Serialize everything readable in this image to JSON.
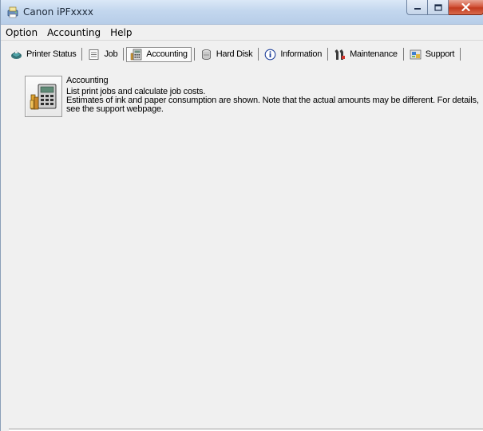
{
  "window": {
    "title": "Canon iPFxxxx",
    "icon": "canon-printer-app-icon",
    "caption_buttons": [
      "minimize",
      "maximize",
      "close"
    ]
  },
  "menubar": {
    "items": [
      {
        "label": "Option"
      },
      {
        "label": "Accounting"
      },
      {
        "label": "Help"
      }
    ]
  },
  "tabs": [
    {
      "label": "Printer Status",
      "icon": "printer-status-icon",
      "active": false
    },
    {
      "label": "Job",
      "icon": "job-list-icon",
      "active": false
    },
    {
      "label": "Accounting",
      "icon": "accounting-icon",
      "active": true
    },
    {
      "label": "Hard Disk",
      "icon": "hard-disk-icon",
      "active": false
    },
    {
      "label": "Information",
      "icon": "information-icon",
      "active": false
    },
    {
      "label": "Maintenance",
      "icon": "maintenance-icon",
      "active": false
    },
    {
      "label": "Support",
      "icon": "support-icon",
      "active": false
    }
  ],
  "accounting_panel": {
    "tile_icon": "accounting-calculator-icon",
    "title": "Accounting",
    "line1": "List print jobs and calculate job costs.",
    "line2": "Estimates of ink and paper consumption are shown. Note that the actual amounts may be different. For details,",
    "line3": "see the support webpage."
  },
  "colors": {
    "titlebar": "#c3d7ee",
    "window_bg": "#f0f0f0",
    "close_button": "#c23b1f"
  }
}
